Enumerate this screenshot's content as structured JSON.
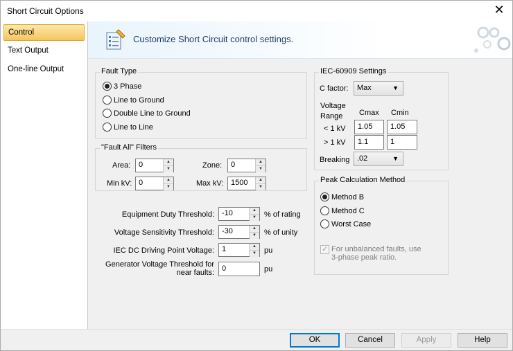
{
  "window": {
    "title": "Short Circuit Options",
    "close_glyph": "✕"
  },
  "sidebar": {
    "items": [
      {
        "label": "Control",
        "active": true
      },
      {
        "label": "Text Output",
        "active": false
      },
      {
        "label": "One-line Output",
        "active": false
      }
    ]
  },
  "header": {
    "title": "Customize Short Circuit control settings.",
    "icon": "settings-sheet-icon",
    "decoration": "gears-decoration-icon"
  },
  "fault_type": {
    "title": "Fault Type",
    "options": [
      "3 Phase",
      "Line to Ground",
      "Double Line to Ground",
      "Line to Line"
    ],
    "selected": "3 Phase"
  },
  "filters": {
    "title": "\"Fault All\" Filters",
    "area_label": "Area:",
    "area_value": "0",
    "zone_label": "Zone:",
    "zone_value": "0",
    "minkv_label": "Min kV:",
    "minkv_value": "0",
    "maxkv_label": "Max kV:",
    "maxkv_value": "1500"
  },
  "thresholds": {
    "duty_label": "Equipment Duty Threshold:",
    "duty_value": "-10",
    "duty_unit": "% of rating",
    "sens_label": "Voltage Sensitivity Threshold:",
    "sens_value": "-30",
    "sens_unit": "% of unity",
    "iec_label": "IEC DC Driving Point Voltage:",
    "iec_value": "1",
    "iec_unit": "pu",
    "gen_label_1": "Generator Voltage Threshold for",
    "gen_label_2": "near faults:",
    "gen_value": "0",
    "gen_unit": "pu"
  },
  "iec": {
    "title": "IEC-60909 Settings",
    "cfactor_label": "C factor:",
    "cfactor_value": "Max",
    "voltage_label": "Voltage",
    "range_label": "Range",
    "cmax_label": "Cmax",
    "cmin_label": "Cmin",
    "lt_label": "< 1 kV",
    "lt_cmax": "1.05",
    "lt_cmin": "1.05",
    "gt_label": "> 1 kV",
    "gt_cmax": "1.1",
    "gt_cmin": "1",
    "breaking_label": "Breaking",
    "breaking_value": ".02"
  },
  "peak": {
    "title": "Peak Calculation Method",
    "options": [
      "Method B",
      "Method C",
      "Worst Case"
    ],
    "selected": "Method B",
    "check_line1": "For unbalanced faults, use",
    "check_line2": "3-phase peak ratio.",
    "check_checked": true
  },
  "buttons": {
    "ok": "OK",
    "cancel": "Cancel",
    "apply": "Apply",
    "help": "Help"
  }
}
